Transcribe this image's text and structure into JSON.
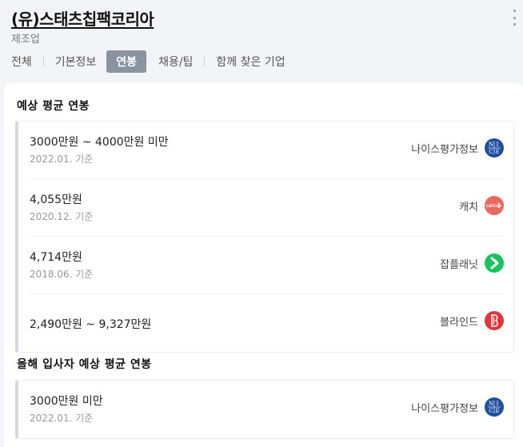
{
  "company": {
    "name": "(유)스태츠칩팩코리아",
    "industry": "제조업"
  },
  "tabs": [
    {
      "label": "전체",
      "active": false
    },
    {
      "label": "기본정보",
      "active": false
    },
    {
      "label": "연봉",
      "active": true
    },
    {
      "label": "채용/팁",
      "active": false
    },
    {
      "label": "함께 찾은 기업",
      "active": false
    }
  ],
  "salary_section": {
    "title": "예상 평균 연봉",
    "rows": [
      {
        "amount": "3000만원 ~ 4000만원 미만",
        "basis": "2022.01. 기준",
        "source": "나이스평가정보",
        "logo": "nice-logo-icon",
        "logo_color": "#1f4e9c"
      },
      {
        "amount": "4,055만원",
        "basis": "2020.12. 기준",
        "source": "캐치",
        "logo": "catch-logo-icon",
        "logo_color": "#e8675f",
        "logo_text": "CATCH"
      },
      {
        "amount": "4,714만원",
        "basis": "2018.06. 기준",
        "source": "잡플래닛",
        "logo": "jobplanet-logo-icon",
        "logo_color": "#17c35d"
      },
      {
        "amount": "2,490만원 ~ 9,327만원",
        "basis": "",
        "source": "블라인드",
        "logo": "blind-logo-icon",
        "logo_color": "#e0363b"
      }
    ]
  },
  "newhire_section": {
    "title": "올해 입사자 예상 평균 연봉",
    "rows": [
      {
        "amount": "3000만원 미만",
        "basis": "2022.01. 기준",
        "source": "나이스평가정보",
        "logo": "nice-logo-icon",
        "logo_color": "#1f4e9c"
      }
    ]
  }
}
